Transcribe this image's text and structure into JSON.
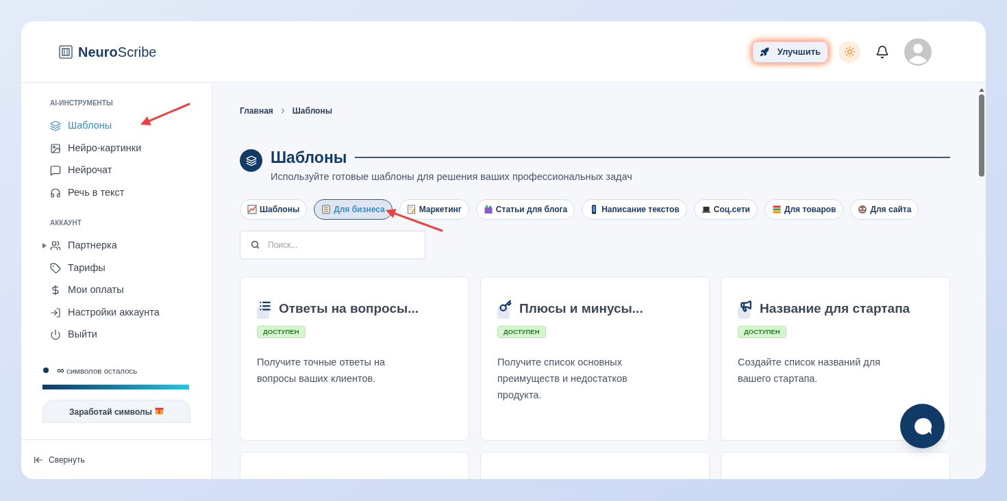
{
  "brand": {
    "bold": "Neuro",
    "light": "Scribe"
  },
  "header": {
    "upgrade": "Улучшить"
  },
  "sidebar": {
    "sections": [
      {
        "title": "AI-ИНСТРУМЕНТЫ",
        "items": [
          {
            "label": "Шаблоны",
            "selected": true,
            "expandable": false
          },
          {
            "label": "Нейро-картинки",
            "selected": false,
            "expandable": false
          },
          {
            "label": "Нейрочат",
            "selected": false,
            "expandable": false
          },
          {
            "label": "Речь в текст",
            "selected": false,
            "expandable": false
          }
        ]
      },
      {
        "title": "АККАУНТ",
        "items": [
          {
            "label": "Партнерка",
            "selected": false,
            "expandable": true
          },
          {
            "label": "Тарифы",
            "selected": false,
            "expandable": false
          },
          {
            "label": "Мои оплаты",
            "selected": false,
            "expandable": false
          },
          {
            "label": "Настройки аккаунта",
            "selected": false,
            "expandable": false
          },
          {
            "label": "Выйти",
            "selected": false,
            "expandable": false
          }
        ]
      }
    ],
    "quota": {
      "amount": "∞",
      "label": "символов осталось",
      "level": 1
    },
    "earn": "Заработай символы",
    "collapse": "Свернуть"
  },
  "breadcrumbs": [
    "Главная",
    "Шаблоны"
  ],
  "page": {
    "title": "Шаблоны",
    "subtitle": "Используйте готовые шаблоны для решения ваших профессиональных задач"
  },
  "filters": [
    {
      "label": "Шаблоны",
      "selected": false
    },
    {
      "label": "Для бизнеса",
      "selected": true
    },
    {
      "label": "Маркетинг",
      "selected": false
    },
    {
      "label": "Статьи для блога",
      "selected": false
    },
    {
      "label": "Написание текстов",
      "selected": false
    },
    {
      "label": "Соц.сети",
      "selected": false
    },
    {
      "label": "Для товаров",
      "selected": false
    },
    {
      "label": "Для сайта",
      "selected": false
    }
  ],
  "search": {
    "placeholder": "Поиск..."
  },
  "cards": [
    {
      "title": "Ответы на вопросы...",
      "badge": "ДОСТУПЕН",
      "description": "Получите точные ответы на вопросы ваших клиентов."
    },
    {
      "title": "Плюсы и минусы...",
      "badge": "ДОСТУПЕН",
      "description": "Получите список основных преимуществ и недостатков продукта."
    },
    {
      "title": "Название для стартапа",
      "badge": "ДОСТУПЕН",
      "description": "Создайте список названий для вашего стартапа."
    }
  ]
}
